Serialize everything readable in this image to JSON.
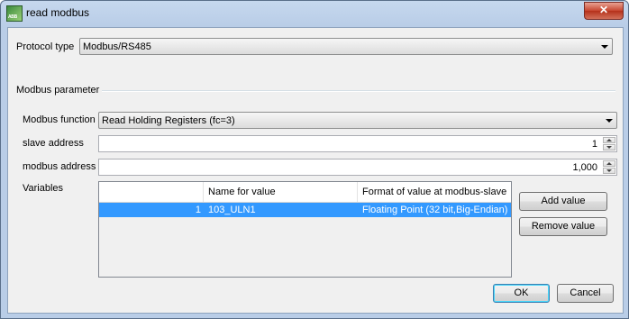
{
  "window": {
    "title": "read modbus",
    "icon_label": "ABB"
  },
  "protocol": {
    "label": "Protocol type",
    "value": "Modbus/RS485"
  },
  "modbus_group": {
    "label": "Modbus parameter"
  },
  "modbus_function": {
    "label": "Modbus function",
    "value": "Read Holding Registers (fc=3)"
  },
  "slave_address": {
    "label": "slave address",
    "value": "1"
  },
  "modbus_address": {
    "label": "modbus address",
    "value": "1,000"
  },
  "variables": {
    "label": "Variables",
    "columns": [
      "",
      "Name for value",
      "Format of value at modbus-slave"
    ],
    "rows": [
      {
        "index": "1",
        "name": "103_ULN1",
        "format": "Floating Point (32 bit,Big-Endian)"
      }
    ],
    "add_label": "Add value",
    "remove_label": "Remove value"
  },
  "buttons": {
    "ok": "OK",
    "cancel": "Cancel"
  },
  "colors": {
    "selection": "#3399ff",
    "title_gradient": "#c6d8ee",
    "close": "#c7452f"
  },
  "icons": {
    "close": "close-icon",
    "app": "app-icon"
  }
}
